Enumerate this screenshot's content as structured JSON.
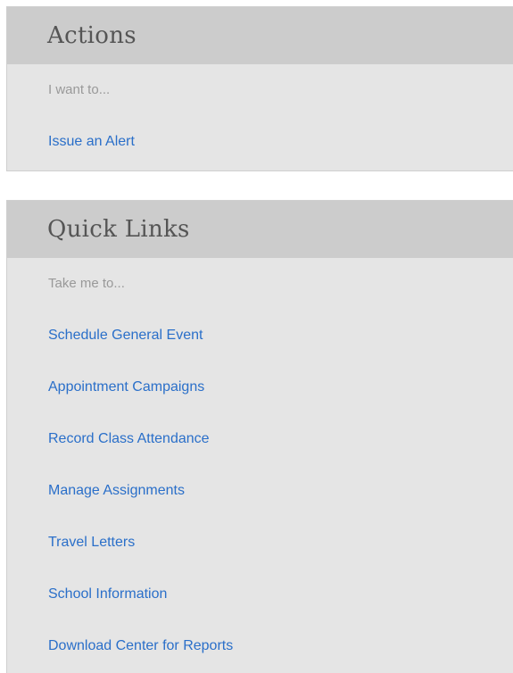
{
  "actions": {
    "title": "Actions",
    "prompt": "I want to...",
    "links": [
      {
        "label": "Issue an Alert"
      }
    ]
  },
  "quick_links": {
    "title": "Quick Links",
    "prompt": "Take me to...",
    "links": [
      {
        "label": "Schedule General Event"
      },
      {
        "label": "Appointment Campaigns"
      },
      {
        "label": "Record Class Attendance"
      },
      {
        "label": "Manage Assignments"
      },
      {
        "label": "Travel Letters"
      },
      {
        "label": "School Information"
      },
      {
        "label": "Download Center for Reports"
      }
    ]
  },
  "colors": {
    "link": "#2a6fc9",
    "panel_bg": "#e5e5e5",
    "header_bg": "#cccccc",
    "prompt_text": "#999999",
    "title_text": "#555555"
  }
}
